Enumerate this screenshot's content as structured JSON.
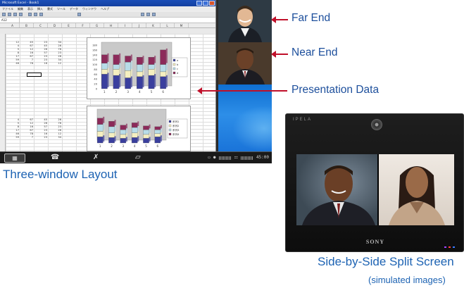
{
  "excel": {
    "title": "Microsoft Excel - Book1",
    "menu": [
      "ファイル",
      "編集",
      "表示",
      "挿入",
      "書式",
      "ツール",
      "データ",
      "ウィンドウ",
      "ヘルプ"
    ],
    "name_box": "A12",
    "columns": [
      "A",
      "B",
      "C",
      "D",
      "E",
      "F",
      "G",
      "H",
      "I",
      "J",
      "K",
      "L",
      "M"
    ],
    "table1": [
      [
        "12",
        "45",
        "23",
        "34"
      ],
      [
        "4",
        "67",
        "45",
        "26"
      ],
      [
        "5",
        "12",
        "26",
        "76"
      ],
      [
        "8",
        "16",
        "57",
        "23"
      ],
      [
        "17",
        "67",
        "23",
        "26"
      ],
      [
        "59",
        "7",
        "23",
        "34"
      ],
      [
        "46",
        "78",
        "16",
        "12"
      ]
    ],
    "table2": [
      [
        "4",
        "67",
        "45",
        "26"
      ],
      [
        "5",
        "12",
        "26",
        "76"
      ],
      [
        "8",
        "16",
        "57",
        "23"
      ],
      [
        "17",
        "67",
        "23",
        "26"
      ],
      [
        "46",
        "78",
        "16",
        "12"
      ],
      [
        "59",
        "7",
        "23",
        "34"
      ]
    ]
  },
  "chart_data": [
    {
      "type": "bar",
      "stacked": true,
      "title": "",
      "categories": [
        "1",
        "2",
        "3",
        "4",
        "5",
        "6"
      ],
      "ylim": [
        0,
        180
      ],
      "yticks": [
        "0",
        "20",
        "40",
        "60",
        "80",
        "100",
        "120",
        "140",
        "160",
        "180"
      ],
      "legend": [
        "a",
        "b",
        "c",
        "d"
      ],
      "series": [
        {
          "values": [
            60,
            55,
            45,
            50,
            55,
            50
          ],
          "color": "#3a3f9e"
        },
        {
          "values": [
            20,
            25,
            30,
            20,
            25,
            20
          ],
          "color": "#f5efc0"
        },
        {
          "values": [
            25,
            20,
            35,
            30,
            20,
            30
          ],
          "color": "#b8dce8"
        },
        {
          "values": [
            35,
            40,
            25,
            30,
            30,
            60
          ],
          "color": "#8c2a5a"
        }
      ]
    },
    {
      "type": "bar",
      "stacked": true,
      "title": "",
      "categories": [
        "1",
        "2",
        "3",
        "4",
        "5",
        "6"
      ],
      "ylim": [
        0,
        200
      ],
      "legend": [
        "系列1",
        "系列2",
        "系列3",
        "系列4"
      ],
      "series": [
        {
          "values": [
            40,
            35,
            30,
            35,
            30,
            40
          ],
          "color": "#3a3f9e"
        },
        {
          "values": [
            35,
            30,
            25,
            30,
            25,
            20
          ],
          "color": "#f5efc0"
        },
        {
          "values": [
            45,
            40,
            30,
            35,
            30,
            25
          ],
          "color": "#b8dce8"
        },
        {
          "values": [
            40,
            35,
            30,
            30,
            25,
            20
          ],
          "color": "#8c2a5a"
        }
      ]
    }
  ],
  "taskbar": {
    "status_time": "45:00",
    "icons": [
      "spreadsheet-icon",
      "phone-icon",
      "mute-icon",
      "document-icon"
    ]
  },
  "callouts": {
    "far_end": "Far End",
    "near_end": "Near End",
    "presentation": "Presentation Data"
  },
  "captions": {
    "three_window": "Three-window Layout",
    "split": "Side-by-Side Split Screen",
    "simulated": "(simulated images)"
  },
  "monitor": {
    "brand_top": "IPELA",
    "brand_bottom": "SONY"
  },
  "colors": {
    "callout_red": "#c0102a",
    "label_blue": "#1d4f9c",
    "caption_blue": "#1d63b3"
  }
}
